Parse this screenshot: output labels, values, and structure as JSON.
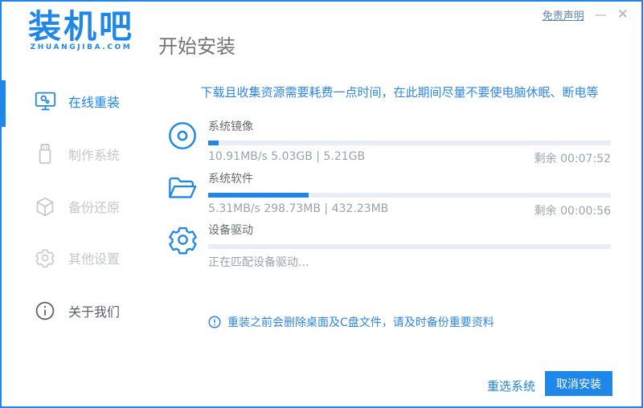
{
  "header": {
    "logo_text": "装机吧",
    "logo_tagline": "ZHUANGJIBA.COM",
    "page_title": "开始安装",
    "disclaimer_link": "免责声明",
    "window_controls": {
      "minimize": "—",
      "close": "✕"
    }
  },
  "sidebar": {
    "items": [
      {
        "label": "在线重装",
        "icon": "monitor-reinstall-icon",
        "state": "active"
      },
      {
        "label": "制作系统",
        "icon": "usb-drive-icon",
        "state": "disabled"
      },
      {
        "label": "备份还原",
        "icon": "backup-box-icon",
        "state": "disabled"
      },
      {
        "label": "其他设置",
        "icon": "settings-gear-icon",
        "state": "disabled"
      },
      {
        "label": "关于我们",
        "icon": "info-icon",
        "state": "normal"
      }
    ]
  },
  "main": {
    "warning_banner": "下载且收集资源需要耗费一点时间，在此期间尽量不要使电脑休眠、断电等",
    "tasks": [
      {
        "name": "系统镜像",
        "icon": "disc-icon",
        "progress_percent": 2.5,
        "stats": "10.91MB/s 5.03GB | 5.21GB",
        "remaining": "剩余 00:07:52"
      },
      {
        "name": "系统软件",
        "icon": "open-folder-icon",
        "progress_percent": 25,
        "stats": "5.31MB/s 298.73MB | 432.23MB",
        "remaining": "剩余 00:00:56"
      },
      {
        "name": "设备驱动",
        "icon": "gear-icon",
        "progress_percent": 0,
        "status": "正在匹配设备驱动..."
      }
    ],
    "notice": "重装之前会删除桌面及C盘文件，请及时备份重要资料"
  },
  "footer": {
    "reselect_label": "重选系统",
    "cancel_label": "取消安装"
  },
  "colors": {
    "brand_blue": "#1f87e8",
    "banner_blue": "#2e86e8",
    "progress_track": "#e9eef6",
    "muted_text": "#9aa3ae",
    "disabled_text": "#c3c7cd",
    "window_border": "#1f87e8"
  }
}
